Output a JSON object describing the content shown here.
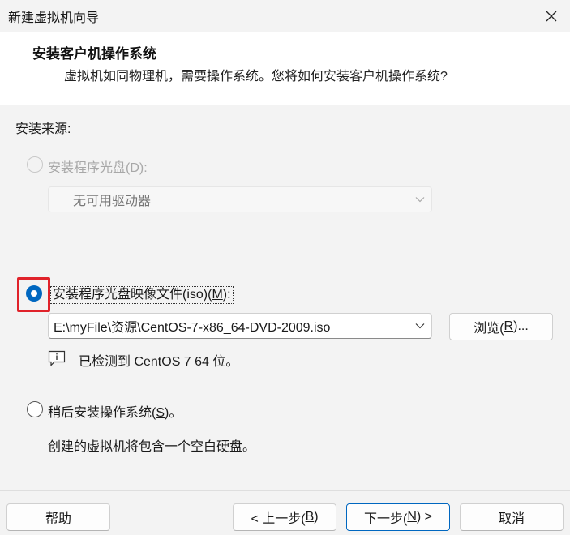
{
  "window": {
    "title": "新建虚拟机向导",
    "close_icon": "close-icon"
  },
  "header": {
    "title": "安装客户机操作系统",
    "subtitle": "虚拟机如同物理机，需要操作系统。您将如何安装客户机操作系统?"
  },
  "install_source": {
    "label": "安装来源:",
    "option_disc": {
      "label_prefix": "安装程序光盘(",
      "mnemonic": "D",
      "label_suffix": "):",
      "enabled": false,
      "selected": false,
      "drive_value": "无可用驱动器"
    },
    "option_iso": {
      "label_prefix": "安装程序光盘映像文件(iso)(",
      "mnemonic": "M",
      "label_suffix": "):",
      "enabled": true,
      "selected": true,
      "path_value": "E:\\myFile\\资源\\CentOS-7-x86_64-DVD-2009.iso",
      "browse_prefix": "浏览(",
      "browse_mnemonic": "R",
      "browse_suffix": ")...",
      "detected_text": "已检测到 CentOS 7 64 位。",
      "info_icon": "info-icon"
    },
    "option_later": {
      "label_prefix": "稍后安装操作系统(",
      "mnemonic": "S",
      "label_suffix": ")。",
      "selected": false,
      "description": "创建的虚拟机将包含一个空白硬盘。"
    }
  },
  "footer": {
    "help": "帮助",
    "back_prefix": "< 上一步(",
    "back_mnemonic": "B",
    "back_suffix": ")",
    "next_prefix": "下一步(",
    "next_mnemonic": "N",
    "next_suffix": ") >",
    "cancel": "取消"
  },
  "colors": {
    "accent": "#0067c0",
    "highlight": "#e0222a"
  }
}
